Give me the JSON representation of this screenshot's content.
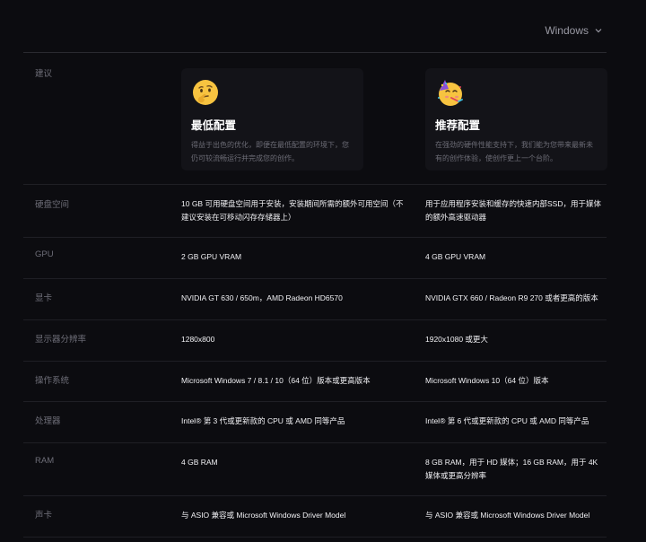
{
  "os_selector": {
    "label": "Windows"
  },
  "recommendation": {
    "label": "建议",
    "min": {
      "title": "最低配置",
      "desc": "得益于出色的优化，即便在最低配置的环境下，您仍可较流畅运行并完成您的创作。"
    },
    "rec": {
      "title": "推荐配置",
      "desc": "在强劲的硬件性能支持下，我们能为您带来最新未有的创作体验，使创作更上一个台阶。"
    }
  },
  "rows": [
    {
      "label": "硬盘空间",
      "min": "10 GB 可用硬盘空间用于安装，安装期间所需的额外可用空间（不建议安装在可移动闪存存储器上）",
      "rec": "用于应用程序安装和缓存的快速内部SSD，用于媒体的额外高速驱动器"
    },
    {
      "label": "GPU",
      "min": "2 GB GPU VRAM",
      "rec": "4 GB GPU VRAM"
    },
    {
      "label": "显卡",
      "min": "NVIDIA GT 630 / 650m，AMD Radeon HD6570",
      "rec": "NVIDIA GTX 660 / Radeon R9 270 或者更高的版本"
    },
    {
      "label": "显示器分辨率",
      "min": "1280x800",
      "rec": "1920x1080 或更大"
    },
    {
      "label": "操作系统",
      "min": "Microsoft Windows 7 / 8.1 / 10（64 位）版本或更高版本",
      "rec": "Microsoft Windows 10（64 位）版本"
    },
    {
      "label": "处理器",
      "min": "Intel® 第 3 代或更新款的 CPU 或 AMD 同等产品",
      "rec": "Intel® 第 6 代或更新款的 CPU 或 AMD 同等产品"
    },
    {
      "label": "RAM",
      "min": "4 GB RAM",
      "rec": "8 GB RAM，用于 HD 媒体；16 GB RAM，用于 4K 媒体或更高分辨率"
    },
    {
      "label": "声卡",
      "min": "与 ASIO 兼容或 Microsoft Windows Driver Model",
      "rec": "与 ASIO 兼容或 Microsoft Windows Driver Model"
    }
  ]
}
